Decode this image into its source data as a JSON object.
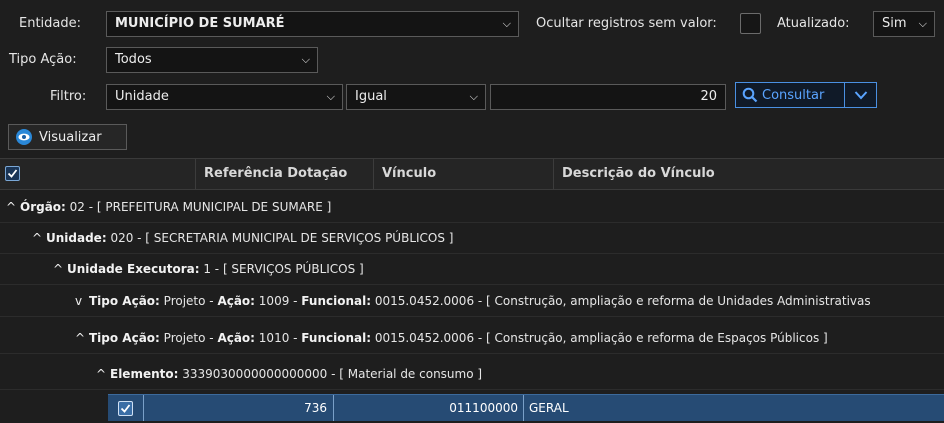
{
  "filters": {
    "entidade_label": "Entidade:",
    "entidade_value": "MUNICÍPIO DE SUMARÉ",
    "ocultar_label": "Ocultar registros sem valor:",
    "atualizado_label": "Atualizado:",
    "atualizado_value": "Sim",
    "tipo_acao_label": "Tipo Ação:",
    "tipo_acao_value": "Todos",
    "filtro_label": "Filtro:",
    "filtro_field": "Unidade",
    "filtro_operator": "Igual",
    "filtro_value": "20",
    "consultar_label": "Consultar"
  },
  "toolbar": {
    "visualizar_label": "Visualizar"
  },
  "grid": {
    "columns": [
      "Referência Dotação",
      "Vínculo",
      "Descrição do Vínculo"
    ],
    "groups": [
      {
        "caret": "^",
        "key": "Órgão:",
        "text": " 02 - [ PREFEITURA MUNICIPAL DE SUMARE ]"
      },
      {
        "caret": "^",
        "key": "Unidade:",
        "text": " 020 - [ SECRETARIA MUNICIPAL DE SERVIÇOS PÚBLICOS ]"
      },
      {
        "caret": "^",
        "key": "Unidade Executora:",
        "text": " 1 - [ SERVIÇOS PÚBLICOS ]"
      },
      {
        "caret": "v",
        "key1": "Tipo Ação:",
        "val1": " Projeto - ",
        "key2": "Ação:",
        "val2": " 1009 - ",
        "key3": "Funcional:",
        "val3": " 0015.0452.0006 - [ Construção, ampliação e reforma de Unidades Administrativas"
      },
      {
        "caret": "^",
        "key1": "Tipo Ação:",
        "val1": " Projeto - ",
        "key2": "Ação:",
        "val2": " 1010 - ",
        "key3": "Funcional:",
        "val3": " 0015.0452.0006 - [ Construção, ampliação e reforma de Espaços Públicos ]"
      },
      {
        "caret": "^",
        "key": "Elemento:",
        "text": " 3339030000000000000 - [ Material de consumo ]"
      }
    ],
    "data_row": {
      "referencia": "736",
      "vinculo": "011100000",
      "descricao": "GERAL"
    }
  }
}
